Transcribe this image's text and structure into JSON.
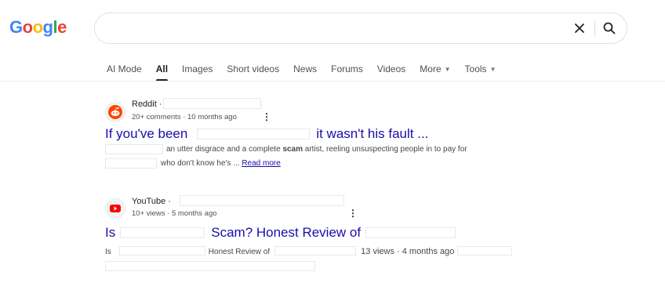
{
  "logo": {
    "letters": [
      "G",
      "o",
      "o",
      "g",
      "l",
      "e"
    ],
    "colors": [
      "#4285f4",
      "#ea4335",
      "#fbbc05",
      "#4285f4",
      "#34a853",
      "#ea4335"
    ]
  },
  "search": {
    "value": "",
    "clear_icon": "close-icon",
    "search_icon": "search-icon"
  },
  "tabs": [
    {
      "label": "AI Mode",
      "active": false
    },
    {
      "label": "All",
      "active": true
    },
    {
      "label": "Images",
      "active": false
    },
    {
      "label": "Short videos",
      "active": false
    },
    {
      "label": "News",
      "active": false
    },
    {
      "label": "Forums",
      "active": false
    },
    {
      "label": "Videos",
      "active": false
    },
    {
      "label": "More",
      "active": false,
      "dropdown": true
    },
    {
      "label": "Tools",
      "active": false,
      "dropdown": true
    }
  ],
  "results": [
    {
      "source": "Reddit",
      "source_suffix": " ·",
      "meta": "20+ comments · 10 months ago",
      "title_a": "If you've been",
      "title_b": "it wasn't his fault ...",
      "snippet_1_a": "an utter disgrace and a complete ",
      "snippet_1_bold": "scam",
      "snippet_1_b": " artist, reeling unsuspecting people in to pay for",
      "snippet_2": "who don't know he's ... ",
      "read_more": "Read more",
      "icon": "reddit-icon",
      "color": "#ff4500"
    },
    {
      "source": "YouTube",
      "source_suffix": " ·",
      "meta": "10+ views · 5 months ago",
      "title_a": "Is",
      "title_b": "Scam? Honest Review of",
      "snippet_a": "Is",
      "snippet_b": "Honest Review of",
      "snippet_c": "13 views · 4 months ago",
      "icon": "youtube-icon",
      "color": "#ff0000"
    }
  ]
}
